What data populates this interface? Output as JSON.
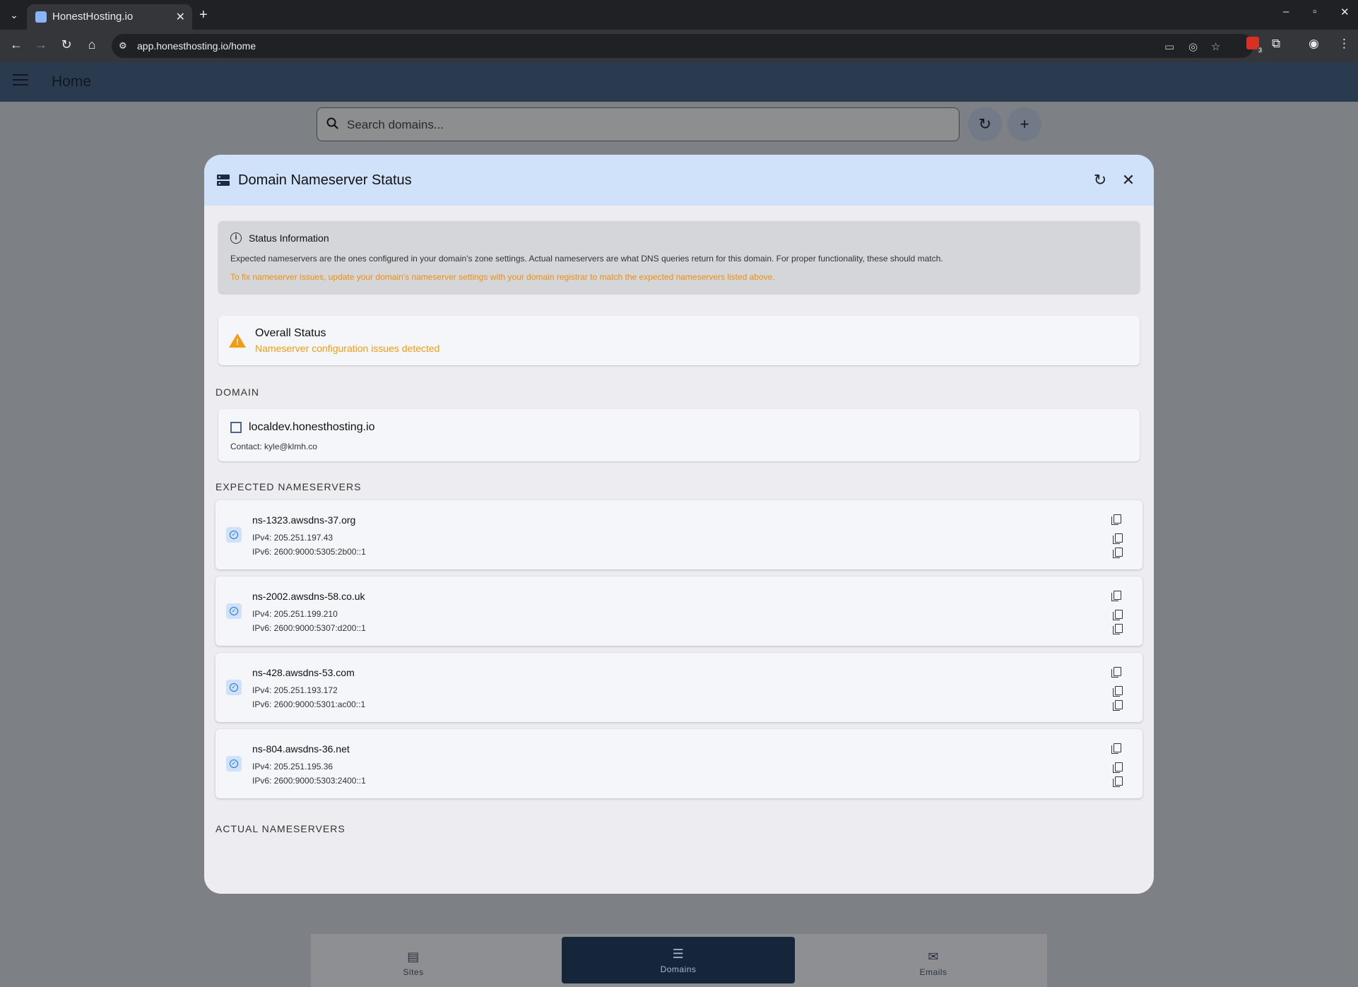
{
  "browser": {
    "tab_title": "HonestHosting.io",
    "url": "app.honesthosting.io/home",
    "extension_badge": "3"
  },
  "app": {
    "title": "Home",
    "search_placeholder": "Search domains..."
  },
  "dialog": {
    "title": "Domain Nameserver Status",
    "info": {
      "title": "Status Information",
      "text": "Expected nameservers are the ones configured in your domain's zone settings. Actual nameservers are what DNS queries return for this domain. For proper functionality, these should match.",
      "warning": "To fix nameserver issues, update your domain's nameserver settings with your domain registrar to match the expected nameservers listed above."
    },
    "overall": {
      "title": "Overall Status",
      "message": "Nameserver configuration issues detected"
    },
    "domain_section_label": "DOMAIN",
    "domain": {
      "name": "localdev.honesthosting.io",
      "contact": "Contact: kyle@klmh.co"
    },
    "expected_label": "EXPECTED NAMESERVERS",
    "expected": [
      {
        "name": "ns-1323.awsdns-37.org",
        "ipv4": "IPv4: 205.251.197.43",
        "ipv6": "IPv6: 2600:9000:5305:2b00::1"
      },
      {
        "name": "ns-2002.awsdns-58.co.uk",
        "ipv4": "IPv4: 205.251.199.210",
        "ipv6": "IPv6: 2600:9000:5307:d200::1"
      },
      {
        "name": "ns-428.awsdns-53.com",
        "ipv4": "IPv4: 205.251.193.172",
        "ipv6": "IPv6: 2600:9000:5301:ac00::1"
      },
      {
        "name": "ns-804.awsdns-36.net",
        "ipv4": "IPv4: 205.251.195.36",
        "ipv6": "IPv6: 2600:9000:5303:2400::1"
      }
    ],
    "actual_label": "ACTUAL NAMESERVERS"
  },
  "bottom_nav": {
    "items": [
      {
        "label": "Sites",
        "icon": "sites-icon"
      },
      {
        "label": "Domains",
        "icon": "domains-icon",
        "active": true
      },
      {
        "label": "Emails",
        "icon": "email-icon"
      }
    ]
  },
  "colors": {
    "appbar": "#4b6789",
    "dialog_header": "#cfe2fa",
    "warning": "#f39c12",
    "check": "#1a73e8"
  }
}
